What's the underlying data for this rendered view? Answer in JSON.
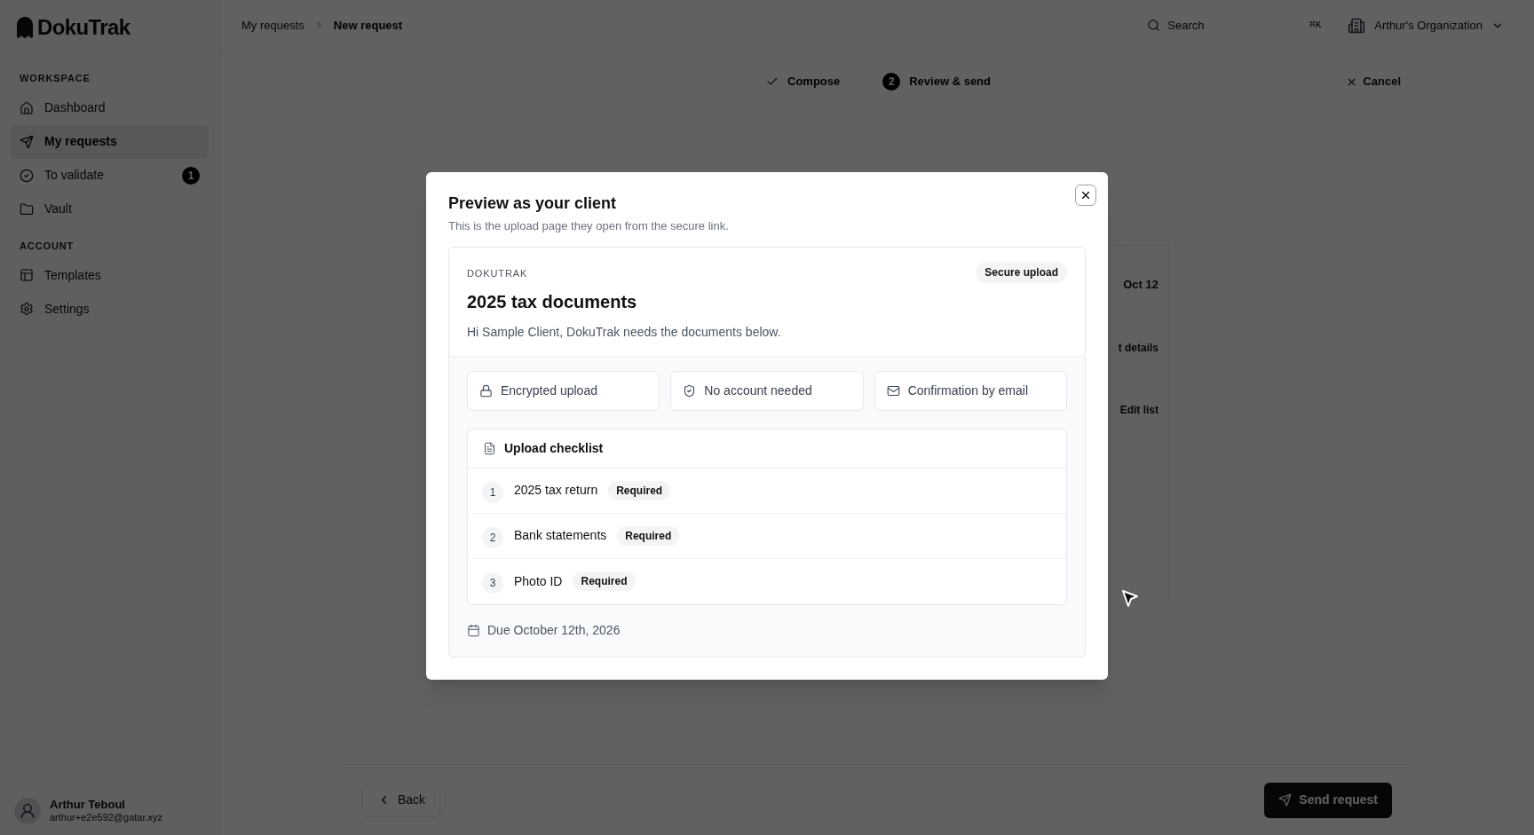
{
  "sidebar": {
    "logo": "DokuTrak",
    "sections": [
      {
        "heading": "WORKSPACE",
        "items": [
          {
            "label": "Dashboard",
            "selected": false
          },
          {
            "label": "My requests",
            "selected": true
          },
          {
            "label": "To validate",
            "selected": false,
            "badge": "1"
          },
          {
            "label": "Vault",
            "selected": false
          }
        ]
      },
      {
        "heading": "ACCOUNT",
        "items": [
          {
            "label": "Templates",
            "selected": false
          },
          {
            "label": "Settings",
            "selected": false
          }
        ]
      }
    ],
    "user": {
      "name": "Arthur Teboul",
      "email": "arthur+e2e592@gatar.xyz"
    }
  },
  "header": {
    "breadcrumbs": [
      "My requests",
      "New request"
    ],
    "search": {
      "placeholder": "Search",
      "shortcut": "⌘K"
    },
    "organization": "Arthur's Organization"
  },
  "stepper": {
    "steps": [
      {
        "label": "Compose",
        "kind": "done"
      },
      {
        "label": "Review & send",
        "kind": "current",
        "number": "2"
      }
    ],
    "cancel": "Cancel"
  },
  "background_card": {
    "texts": [
      "Oct 12",
      "t details",
      "Edit list"
    ]
  },
  "footer": {
    "back": "Back",
    "send": "Send request"
  },
  "modal": {
    "title": "Preview as your client",
    "subtitle": "This is the upload page they open from the secure link.",
    "preview": {
      "brand": "DOKUTRAK",
      "badge": "Secure upload",
      "title": "2025 tax documents",
      "greeting": "Hi Sample Client, DokuTrak needs the documents below.",
      "features": [
        {
          "label": "Encrypted upload"
        },
        {
          "label": "No account needed"
        },
        {
          "label": "Confirmation by email"
        }
      ],
      "checklist": {
        "title": "Upload checklist",
        "items": [
          {
            "number": "1",
            "name": "2025 tax return",
            "tag": "Required"
          },
          {
            "number": "2",
            "name": "Bank statements",
            "tag": "Required"
          },
          {
            "number": "3",
            "name": "Photo ID",
            "tag": "Required"
          }
        ]
      },
      "due": "Due October 12th, 2026"
    }
  }
}
